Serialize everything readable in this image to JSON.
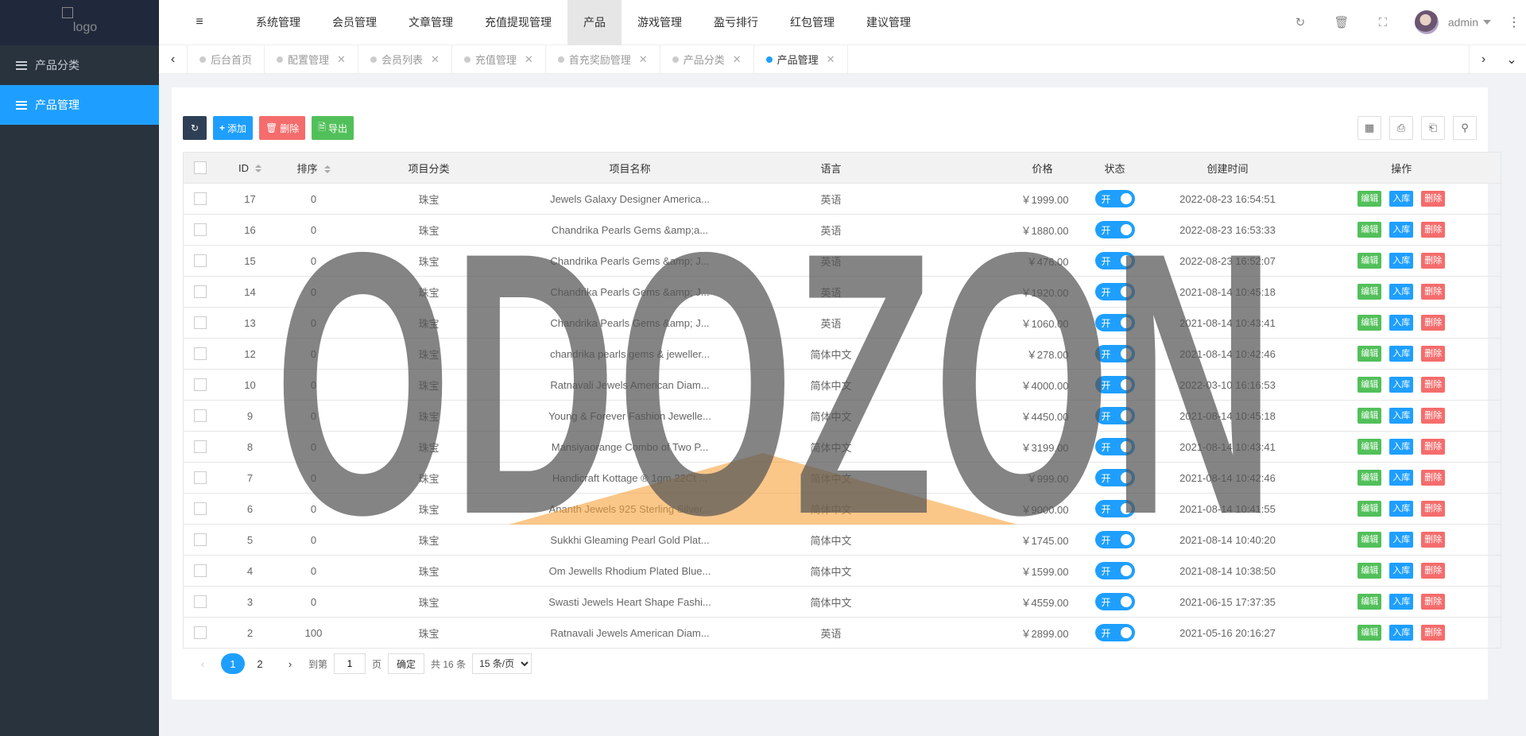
{
  "sidebar": {
    "logo_alt": "logo",
    "items": [
      {
        "label": "产品分类",
        "active": false
      },
      {
        "label": "产品管理",
        "active": true
      }
    ]
  },
  "header": {
    "nav": [
      {
        "label": "系统管理"
      },
      {
        "label": "会员管理"
      },
      {
        "label": "文章管理"
      },
      {
        "label": "充值提现管理"
      },
      {
        "label": "产品",
        "active": true
      },
      {
        "label": "游戏管理"
      },
      {
        "label": "盈亏排行"
      },
      {
        "label": "红包管理"
      },
      {
        "label": "建议管理"
      }
    ],
    "username": "admin"
  },
  "tabs": [
    {
      "label": "后台首页"
    },
    {
      "label": "配置管理"
    },
    {
      "label": "会员列表"
    },
    {
      "label": "充值管理"
    },
    {
      "label": "首充奖励管理"
    },
    {
      "label": "产品分类"
    },
    {
      "label": "产品管理",
      "active": true
    }
  ],
  "toolbar": {
    "add": "添加",
    "delete": "删除",
    "export": "导出"
  },
  "table": {
    "columns": [
      "ID",
      "排序",
      "项目分类",
      "项目名称",
      "语言",
      "价格",
      "状态",
      "创建时间",
      "操作"
    ],
    "switch_on": "开",
    "op_edit": "编辑",
    "op_stock": "入库",
    "op_delete": "删除",
    "rows": [
      {
        "id": "17",
        "sort": "0",
        "category": "珠宝",
        "name": "Jewels Galaxy Designer America...",
        "lang": "英语",
        "price": "￥1999.00",
        "created": "2022-08-23 16:54:51"
      },
      {
        "id": "16",
        "sort": "0",
        "category": "珠宝",
        "name": "Chandrika Pearls Gems &amp;a...",
        "lang": "英语",
        "price": "￥1880.00",
        "created": "2022-08-23 16:53:33"
      },
      {
        "id": "15",
        "sort": "0",
        "category": "珠宝",
        "name": "Chandrika Pearls Gems &amp; J...",
        "lang": "英语",
        "price": "￥476.00",
        "created": "2022-08-23 16:52:07"
      },
      {
        "id": "14",
        "sort": "0",
        "category": "珠宝",
        "name": "Chandrika Pearls Gems &amp; J...",
        "lang": "英语",
        "price": "￥1920.00",
        "created": "2021-08-14 10:45:18"
      },
      {
        "id": "13",
        "sort": "0",
        "category": "珠宝",
        "name": "Chandrika Pearls Gems &amp; J...",
        "lang": "英语",
        "price": "￥1060.00",
        "created": "2021-08-14 10:43:41"
      },
      {
        "id": "12",
        "sort": "0",
        "category": "珠宝",
        "name": "chandrika pearls gems & jeweller...",
        "lang": "简体中文",
        "price": "￥278.00",
        "created": "2021-08-14 10:42:46"
      },
      {
        "id": "10",
        "sort": "0",
        "category": "珠宝",
        "name": "Ratnavali Jewels American Diam...",
        "lang": "简体中文",
        "price": "￥4000.00",
        "created": "2022-03-10 16:16:53"
      },
      {
        "id": "9",
        "sort": "0",
        "category": "珠宝",
        "name": "Young & Forever Fashion Jewelle...",
        "lang": "简体中文",
        "price": "￥4450.00",
        "created": "2021-08-14 10:45:18"
      },
      {
        "id": "8",
        "sort": "0",
        "category": "珠宝",
        "name": "Mansiyaorange Combo of Two P...",
        "lang": "简体中文",
        "price": "￥3199.00",
        "created": "2021-08-14 10:43:41"
      },
      {
        "id": "7",
        "sort": "0",
        "category": "珠宝",
        "name": "Handicraft Kottage ® 1gm 22Ct ...",
        "lang": "简体中文",
        "price": "￥999.00",
        "created": "2021-08-14 10:42:46"
      },
      {
        "id": "6",
        "sort": "0",
        "category": "珠宝",
        "name": "Ananth Jewels 925 Sterling Silver...",
        "lang": "简体中文",
        "price": "￥9000.00",
        "created": "2021-08-14 10:41:55"
      },
      {
        "id": "5",
        "sort": "0",
        "category": "珠宝",
        "name": "Sukkhi Gleaming Pearl Gold Plat...",
        "lang": "简体中文",
        "price": "￥1745.00",
        "created": "2021-08-14 10:40:20"
      },
      {
        "id": "4",
        "sort": "0",
        "category": "珠宝",
        "name": "Om Jewells Rhodium Plated Blue...",
        "lang": "简体中文",
        "price": "￥1599.00",
        "created": "2021-08-14 10:38:50"
      },
      {
        "id": "3",
        "sort": "0",
        "category": "珠宝",
        "name": "Swasti Jewels Heart Shape Fashi...",
        "lang": "简体中文",
        "price": "￥4559.00",
        "created": "2021-06-15 17:37:35"
      },
      {
        "id": "2",
        "sort": "100",
        "category": "珠宝",
        "name": "Ratnavali Jewels American Diam...",
        "lang": "英语",
        "price": "￥2899.00",
        "created": "2021-05-16 20:16:27"
      }
    ]
  },
  "pager": {
    "pages": [
      "1",
      "2"
    ],
    "goto_label": "到第",
    "page_value": "1",
    "page_unit": "页",
    "confirm": "确定",
    "total": "共 16 条",
    "per_page": "15 条/页"
  },
  "watermark": {
    "text": "ODOZON"
  },
  "colors": {
    "primary": "#1e9fff",
    "sidebar": "#28333e",
    "green": "#52c05a",
    "red": "#f56c6c",
    "watermark_accent": "#f7a13a"
  }
}
